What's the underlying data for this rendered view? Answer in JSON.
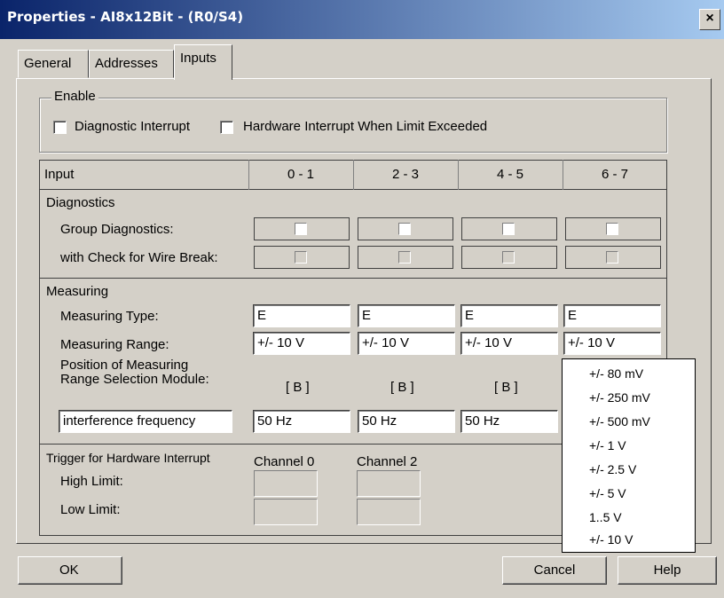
{
  "window": {
    "title": "Properties - AI8x12Bit - (R0/S4)",
    "close_label": "×"
  },
  "tabs": [
    "General",
    "Addresses",
    "Inputs"
  ],
  "enable": {
    "legend": "Enable",
    "diagnostic_interrupt": "Diagnostic Interrupt",
    "hardware_interrupt": "Hardware Interrupt When Limit Exceeded"
  },
  "table": {
    "header_label": "Input",
    "columns": [
      "0 - 1",
      "2 - 3",
      "4 - 5",
      "6 - 7"
    ],
    "diagnostics": {
      "title": "Diagnostics",
      "group_label": "Group Diagnostics:",
      "wire_break_label": "with Check for Wire Break:"
    },
    "measuring": {
      "title": "Measuring",
      "type_label": "Measuring Type:",
      "type_values": [
        "E",
        "E",
        "E",
        "E"
      ],
      "range_label": "Measuring Range:",
      "range_values": [
        "+/- 10 V",
        "+/- 10 V",
        "+/- 10 V",
        "+/- 10 V"
      ],
      "position_label_1": "Position of Measuring",
      "position_label_2": "Range Selection Module:",
      "position_values": [
        "[ B ]",
        "[ B ]",
        "[ B ]"
      ],
      "interference_label": "interference frequency",
      "interference_values": [
        "50 Hz",
        "50 Hz",
        "50 Hz"
      ]
    },
    "trigger": {
      "title": "Trigger for Hardware Interrupt",
      "high_label": "High Limit:",
      "low_label": "Low Limit:",
      "channels": [
        "Channel 0",
        "Channel 2"
      ]
    }
  },
  "range_dropdown": {
    "options": [
      "+/- 80 mV",
      "+/- 250 mV",
      "+/- 500 mV",
      "+/- 1 V",
      "+/- 2.5 V",
      "+/- 5 V",
      "1..5 V",
      "+/- 10 V"
    ]
  },
  "buttons": {
    "ok": "OK",
    "cancel": "Cancel",
    "help": "Help"
  }
}
